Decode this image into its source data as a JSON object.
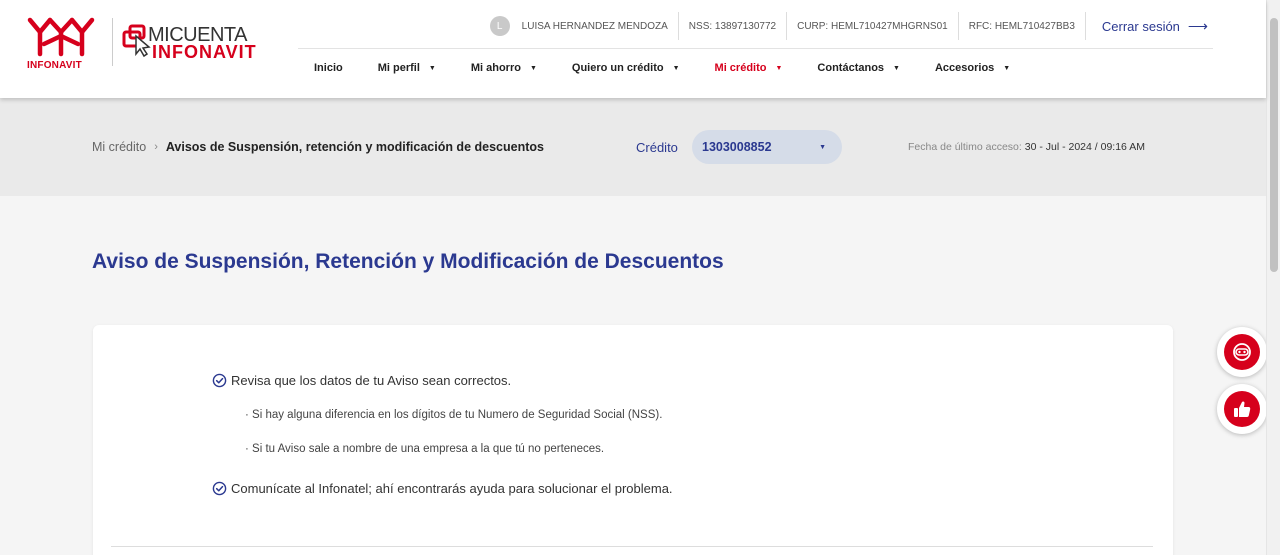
{
  "brand": {
    "infonavit_text": "INFONAVIT",
    "micuenta_line1": "MICUENTA",
    "micuenta_line2": "INFONAVIT",
    "accent": "#d6001c",
    "primary": "#2b3990"
  },
  "user": {
    "initial": "L",
    "name": "LUISA HERNANDEZ MENDOZA",
    "nss": "NSS: 13897130772",
    "curp": "CURP: HEML710427MHGRNS01",
    "rfc": "RFC: HEML710427BB3",
    "logout": "Cerrar sesión"
  },
  "nav": {
    "items": [
      {
        "label": "Inicio"
      },
      {
        "label": "Mi perfil"
      },
      {
        "label": "Mi ahorro"
      },
      {
        "label": "Quiero un crédito"
      },
      {
        "label": "Mi crédito"
      },
      {
        "label": "Contáctanos"
      },
      {
        "label": "Accesorios"
      }
    ]
  },
  "breadcrumb": {
    "parent": "Mi crédito",
    "current": "Avisos de Suspensión, retención y modificación de descuentos"
  },
  "credit": {
    "label": "Crédito",
    "selected": "1303008852"
  },
  "last_access": {
    "label": "Fecha de último acceso:",
    "value": "30 - Jul - 2024 / 09:16 AM"
  },
  "page": {
    "title": "Aviso de Suspensión, Retención y Modificación de Descuentos"
  },
  "card": {
    "check1": "Revisa que los datos de tu Aviso sean correctos.",
    "sub1": "· Si hay alguna diferencia en los dígitos de tu Numero de Seguridad Social (NSS).",
    "sub2": "· Si tu Aviso sale a nombre de una empresa a la que tú no perteneces.",
    "check2": "Comunícate al Infonatel; ahí encontrarás ayuda para solucionar el problema."
  }
}
